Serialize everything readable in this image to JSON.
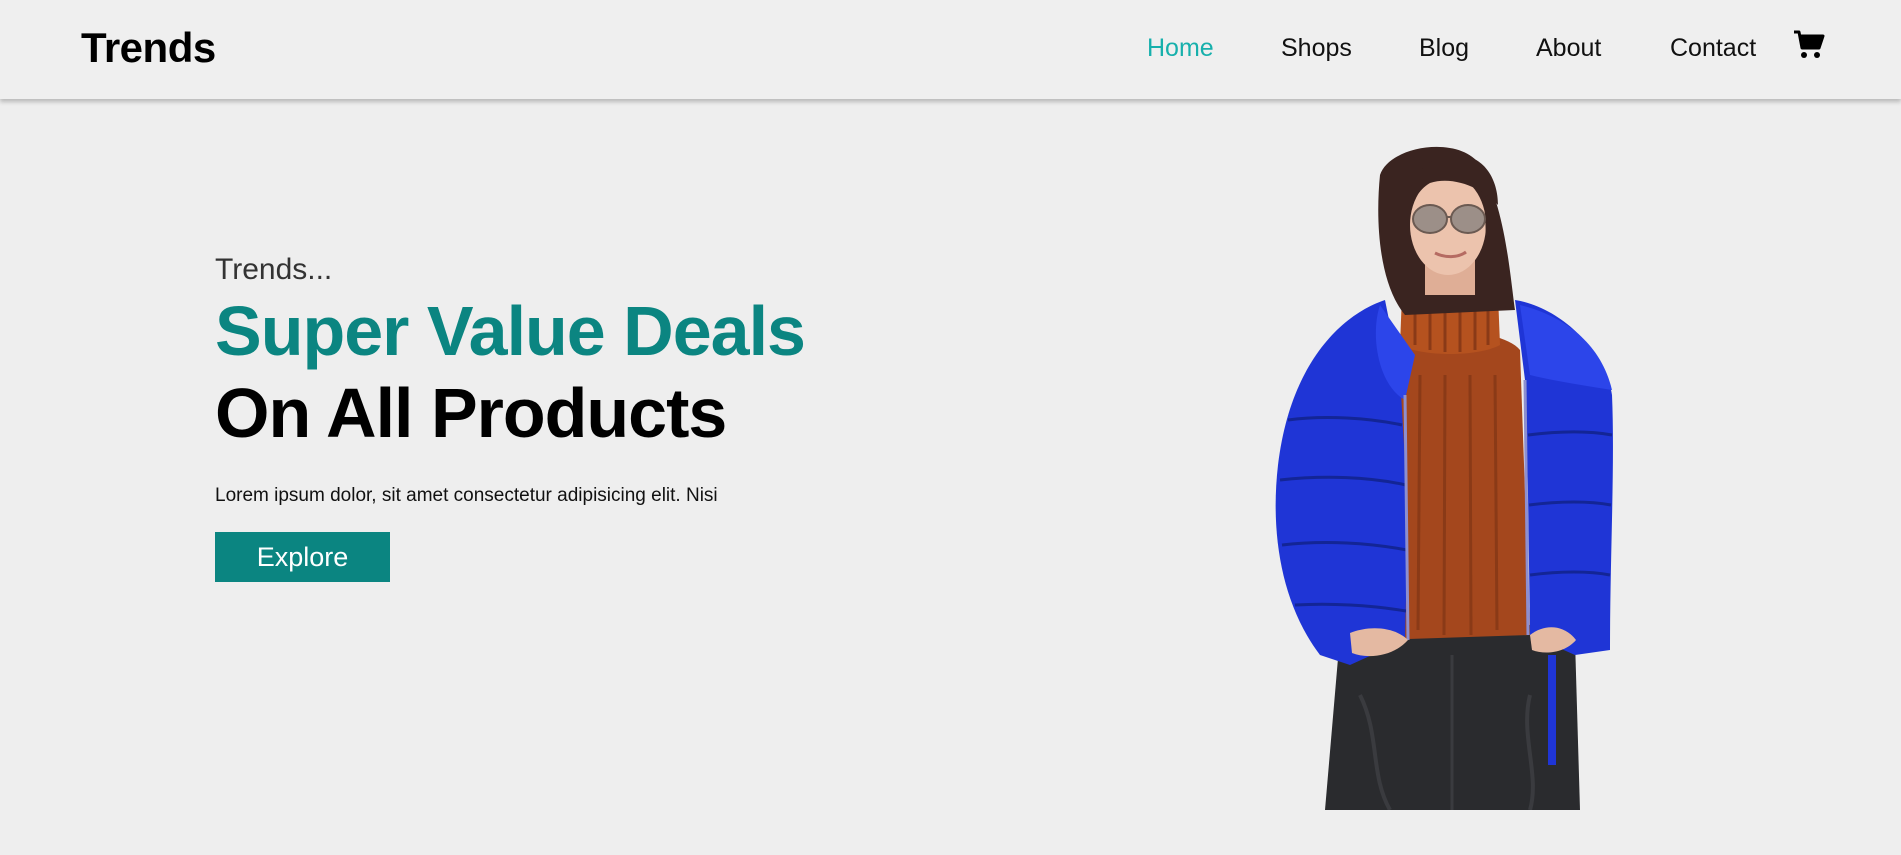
{
  "brand": {
    "name": "Trends"
  },
  "nav": {
    "items": [
      {
        "label": "Home",
        "active": true
      },
      {
        "label": "Shops",
        "active": false
      },
      {
        "label": "Blog",
        "active": false
      },
      {
        "label": "About",
        "active": false
      },
      {
        "label": "Contact",
        "active": false
      }
    ],
    "cart_icon": "shopping-cart-icon"
  },
  "hero": {
    "eyebrow": "Trends...",
    "headline_accent": "Super Value Deals",
    "headline_main": "On All Products",
    "description": "Lorem ipsum dolor, sit amet consectetur adipisicing elit. Nisi",
    "cta_label": "Explore",
    "image_icon": "woman-in-blue-puffer-jacket-photo"
  },
  "colors": {
    "accent": "#17b0ac",
    "brand_teal": "#0b8581",
    "background": "#eeeeee",
    "text": "#000000"
  }
}
